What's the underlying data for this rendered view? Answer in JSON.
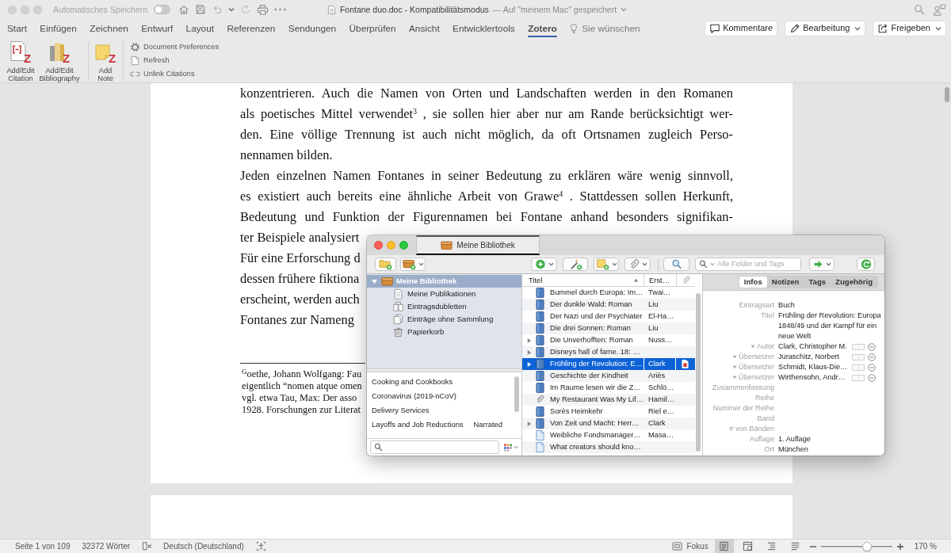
{
  "window": {
    "autosave_label": "Automatisches Speichern",
    "autosave_on": false,
    "title": "Fontane duo.doc - Kompatibilitätsmodus",
    "title_status": "— Auf \"meinem Mac\" gespeichert"
  },
  "ribbon_tabs": [
    {
      "label": "Start",
      "selected": false
    },
    {
      "label": "Einfügen",
      "selected": false
    },
    {
      "label": "Zeichnen",
      "selected": false
    },
    {
      "label": "Entwurf",
      "selected": false
    },
    {
      "label": "Layout",
      "selected": false
    },
    {
      "label": "Referenzen",
      "selected": false
    },
    {
      "label": "Sendungen",
      "selected": false
    },
    {
      "label": "Überprüfen",
      "selected": false
    },
    {
      "label": "Ansicht",
      "selected": false
    },
    {
      "label": "Entwicklertools",
      "selected": false
    },
    {
      "label": "Zotero",
      "selected": true
    }
  ],
  "tell_me": {
    "label": "Sie wünschen"
  },
  "header_buttons": [
    {
      "label": "Kommentare",
      "kind": "comment",
      "dropdown": false
    },
    {
      "label": "Bearbeitung",
      "kind": "edit",
      "dropdown": true
    },
    {
      "label": "Freigeben",
      "kind": "share",
      "dropdown": true
    }
  ],
  "ribbon": {
    "groups": [
      [
        {
          "label": "Add/Edit Citation",
          "kind": "citation",
          "mark": "Z"
        },
        {
          "label": "Add/Edit Bibliography",
          "kind": "bibliography",
          "mark": "Z"
        }
      ],
      [
        {
          "label": "Add Note",
          "kind": "note",
          "mark": "Z"
        }
      ]
    ],
    "small_buttons": [
      {
        "label": "Document Preferences",
        "kind": "preferences"
      },
      {
        "label": "Refresh",
        "kind": "refresh"
      },
      {
        "label": "Unlink Citations",
        "kind": "unlink"
      }
    ]
  },
  "document": {
    "lines": [
      {
        "text": "konzentrieren. Auch die Namen von Orten und Landschaften werden in den Romanen",
        "justified": true
      },
      {
        "text": "als poetisches Mittel verwendet$^{3}$ , sie sollen hier aber nur am Rande berücksichtigt wer-",
        "justified": true
      },
      {
        "text": "den. Eine völlige Trennung ist auch nicht möglich, da oft Ortsnamen zugleich Perso-",
        "justified": true
      },
      {
        "text": "nennamen bilden.",
        "justified": false
      },
      {
        "text": "Jeden einzelnen Namen Fontanes in seiner Bedeutung zu erklären wäre wenig sinnvoll,",
        "justified": true
      },
      {
        "text": "es existiert auch bereits eine ähnliche Arbeit von Grawe$^{4}$ . Stattdessen sollen Herkunft,",
        "justified": true
      },
      {
        "text": "Bedeutung und Funktion der Figurennamen bei Fontane anhand besonders signifikan-",
        "justified": true
      },
      {
        "text": "ter Beispiele analysiert",
        "justified": false
      },
      {
        "text": "Für eine Erforschung d",
        "justified": false
      },
      {
        "text": "dessen frühere fiktiona",
        "justified": false
      },
      {
        "text": "erscheint, werden auch",
        "justified": false
      },
      {
        "text": "Fontanes zur Nameng",
        "justified": false
      }
    ],
    "footnote_lines": [
      "$^{G}$oethe, Johann Wolfgang: Fau",
      "eigentlich “nomen atque omen",
      "vgl. etwa Tau, Max: Der asso",
      "1928. Forschungen zur Literat"
    ]
  },
  "zotero": {
    "tab": "Meine Bibliothek",
    "search_placeholder": "Alle Felder und Tags",
    "collections": [
      {
        "label": "Meine Bibliothek",
        "kind": "library",
        "selected": true,
        "expanded": true,
        "children": [
          {
            "label": "Meine Publikationen",
            "kind": "publications",
            "selected": false
          },
          {
            "label": "Eintragsdubletten",
            "kind": "duplicates",
            "selected": false
          },
          {
            "label": "Einträge ohne Sammlung",
            "kind": "unfiled",
            "selected": false
          },
          {
            "label": "Papierkorb",
            "kind": "trash",
            "selected": false
          }
        ]
      }
    ],
    "tags": [
      "Cooking and Cookbooks",
      "Coronavirus (2019-nCoV)",
      "Delivery Services",
      "Layoffs and Job Reductions",
      "Narrated"
    ],
    "columns": [
      {
        "label": "Titel",
        "sorted": true
      },
      {
        "label": "Erst…",
        "sorted": false
      }
    ],
    "items": [
      {
        "title": "Bummel durch Europa: Im…",
        "creator": "Twai…",
        "kind": "book",
        "expandable": false,
        "selected": false,
        "pdf_attachment": false
      },
      {
        "title": "Der dunkle Wald: Roman",
        "creator": "Liu",
        "kind": "book",
        "expandable": false,
        "selected": false,
        "pdf_attachment": false
      },
      {
        "title": "Der Nazi und der Psychiater",
        "creator": "El-Ha…",
        "kind": "book",
        "expandable": false,
        "selected": false,
        "pdf_attachment": false
      },
      {
        "title": "Die drei Sonnen: Roman",
        "creator": "Liu",
        "kind": "book",
        "expandable": false,
        "selected": false,
        "pdf_attachment": false
      },
      {
        "title": "Die Unverhofften: Roman",
        "creator": "Nuss…",
        "kind": "book",
        "expandable": true,
        "selected": false,
        "pdf_attachment": false
      },
      {
        "title": "Disneys hall of fame. 18: …",
        "kind": "book",
        "expandable": true,
        "selected": false,
        "pdf_attachment": false
      },
      {
        "title": "Frühling der Revolution: E…",
        "creator": "Clark",
        "kind": "book",
        "expandable": true,
        "selected": true,
        "pdf_attachment": true
      },
      {
        "title": "Geschichte der Kindheit",
        "creator": "Ariès",
        "kind": "book",
        "expandable": false,
        "selected": false,
        "pdf_attachment": false
      },
      {
        "title": "Im Raume lesen wir die Z…",
        "creator": "Schlö…",
        "kind": "book",
        "expandable": false,
        "selected": false,
        "pdf_attachment": false
      },
      {
        "title": "My Restaurant Was My Lif…",
        "creator": "Hamil…",
        "kind": "attachment",
        "expandable": false,
        "selected": false,
        "pdf_attachment": false
      },
      {
        "title": "Sorès Heimkehr",
        "creator": "Riel e…",
        "kind": "book",
        "expandable": false,
        "selected": false,
        "pdf_attachment": false
      },
      {
        "title": "Von Zeit und Macht: Herr…",
        "creator": "Clark",
        "kind": "book",
        "expandable": true,
        "selected": false,
        "pdf_attachment": false
      },
      {
        "title": "Weibliche Fondsmanager…",
        "creator": "Masa…",
        "kind": "document",
        "expandable": false,
        "selected": false,
        "pdf_attachment": false
      },
      {
        "title": "What creators should kno…",
        "kind": "document",
        "expandable": false,
        "selected": false,
        "pdf_attachment": false
      }
    ],
    "pane_tabs": [
      {
        "label": "Infos",
        "selected": true
      },
      {
        "label": "Notizen",
        "selected": false
      },
      {
        "label": "Tags",
        "selected": false
      },
      {
        "label": "Zugehörig",
        "selected": false
      }
    ],
    "fields": [
      {
        "label": "Eintragsart",
        "value": "Buch",
        "kind": "plain"
      },
      {
        "label": "Titel",
        "lines": [
          "Frühling der Revolution: Europa",
          "1848/49 und der Kampf für ein",
          "neue Welt"
        ],
        "kind": "plain"
      },
      {
        "label": "Autor",
        "value": "Clark, Christopher M.",
        "kind": "creator"
      },
      {
        "label": "Übersetzer",
        "value": "Juraschitz, Norbert",
        "kind": "creator"
      },
      {
        "label": "Übersetzer",
        "value": "Schmidt, Klaus-Die…",
        "kind": "creator"
      },
      {
        "label": "Übersetzer",
        "value": "Wirthensohn, Andr…",
        "kind": "creator"
      },
      {
        "label": "Zusammenfassung",
        "kind": "plain"
      },
      {
        "label": "Reihe",
        "kind": "plain"
      },
      {
        "label": "Nummer der Reihe",
        "kind": "plain"
      },
      {
        "label": "Band",
        "kind": "plain"
      },
      {
        "label": "# von Bänden",
        "kind": "plain"
      },
      {
        "label": "Auflage",
        "value": "1. Auflage",
        "kind": "plain"
      },
      {
        "label": "Ort",
        "value": "München",
        "kind": "plain"
      }
    ]
  },
  "status_bar": {
    "page": "Seite 1 von 109",
    "words": "32372 Wörter",
    "language": "Deutsch (Deutschland)",
    "focus": "Fokus",
    "views": [
      {
        "kind": "print",
        "selected": true
      },
      {
        "kind": "web",
        "selected": false
      },
      {
        "kind": "outline",
        "selected": false
      },
      {
        "kind": "draft",
        "selected": false
      }
    ],
    "zoom": {
      "level": 0.67,
      "reading": "170 %"
    }
  }
}
